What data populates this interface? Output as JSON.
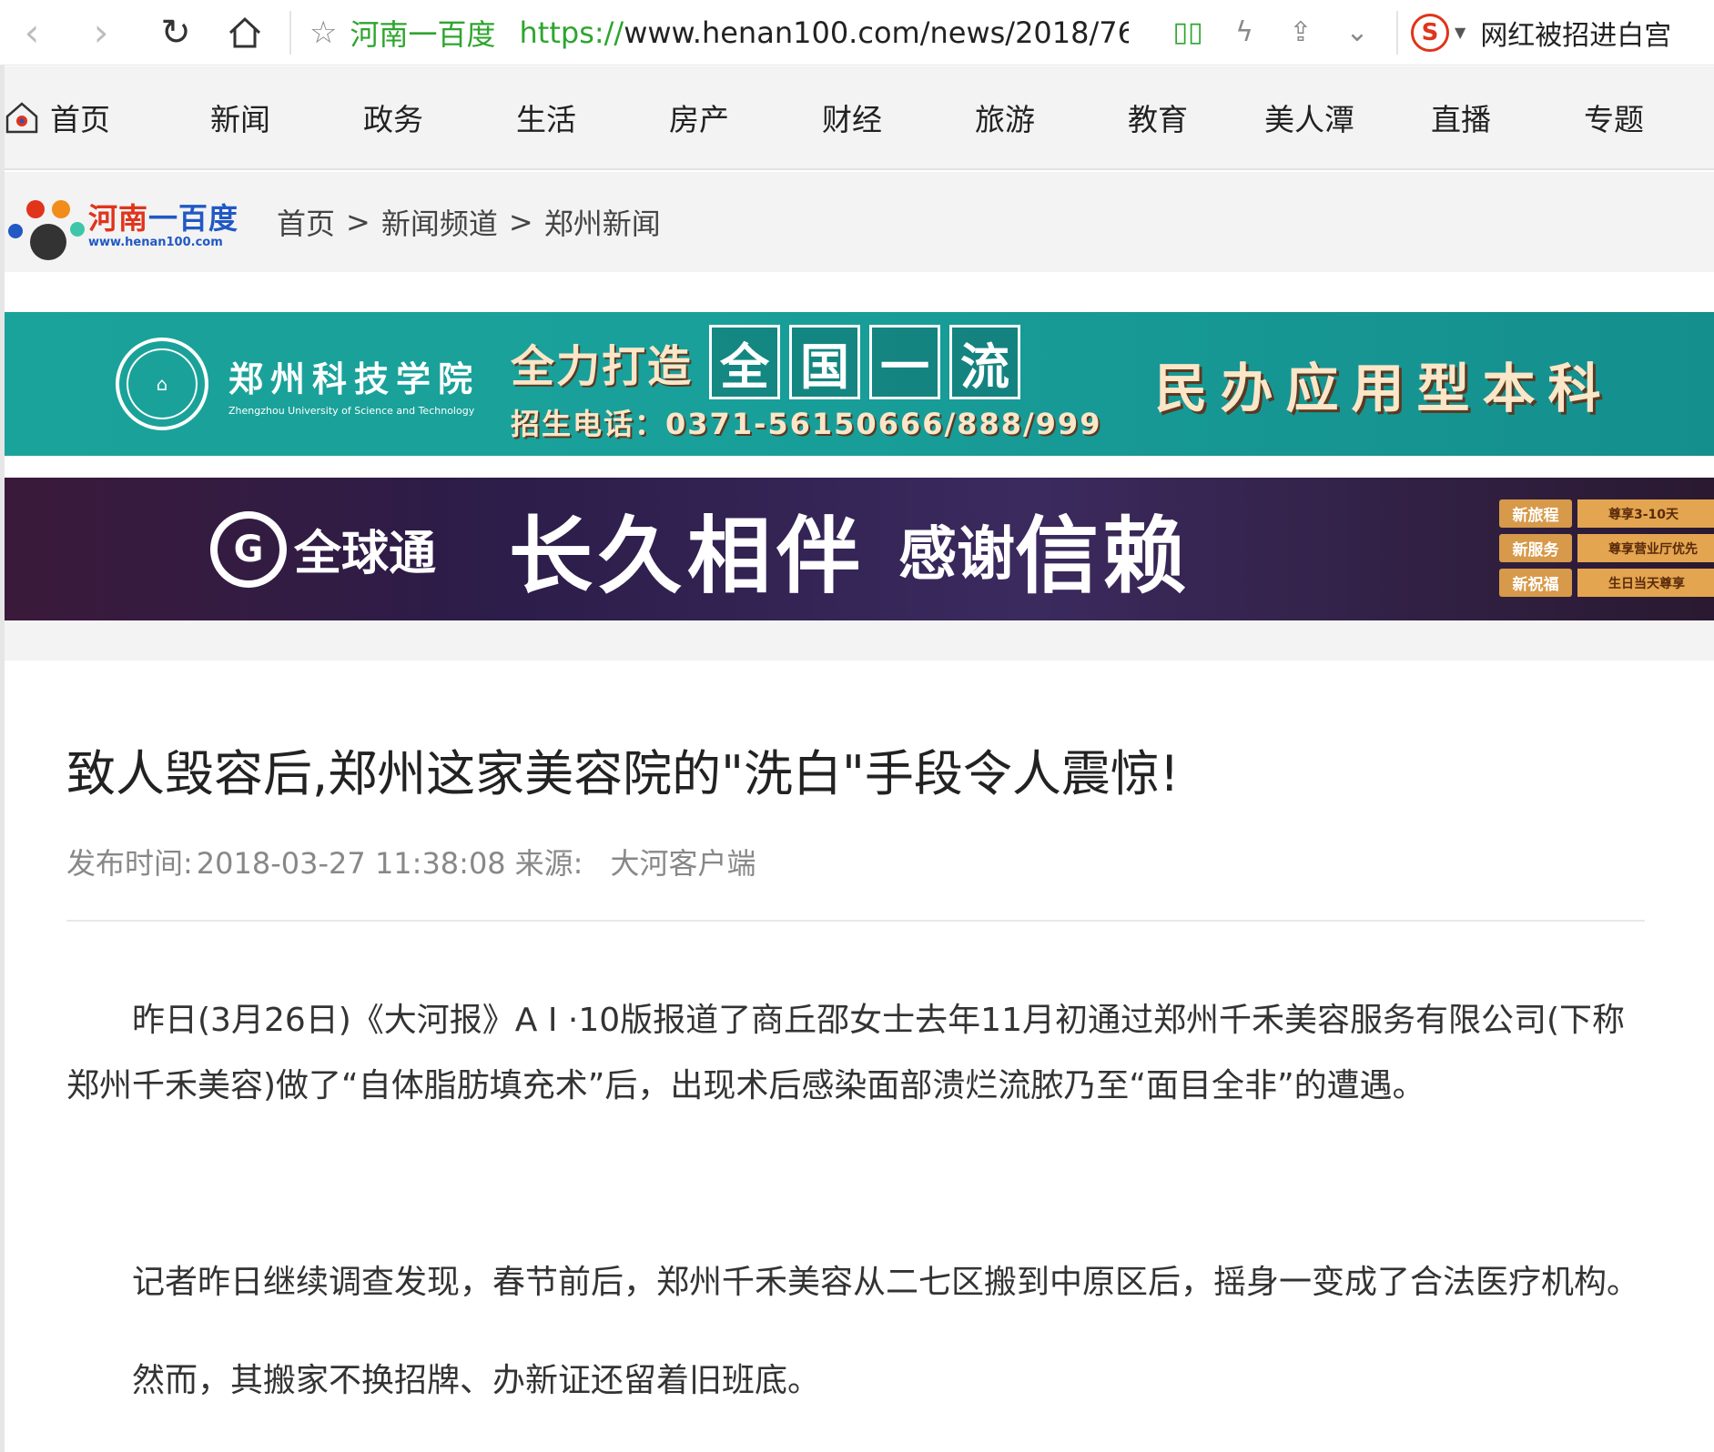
{
  "browser": {
    "site_name": "河南一百度",
    "url_proto": "https://",
    "url_rest": "www.henan100.com/news/2018/76",
    "search_text": "网红被招进白宫",
    "search_engine_letter": "S"
  },
  "nav": {
    "items": [
      "首页",
      "新闻",
      "政务",
      "生活",
      "房产",
      "财经",
      "旅游",
      "教育",
      "美人潭",
      "直播",
      "专题"
    ]
  },
  "logo": {
    "cn_part1": "河南",
    "cn_part2": "一百度",
    "url": "www.henan100.com"
  },
  "breadcrumb": {
    "items": [
      "首页",
      "新闻频道",
      "郑州新闻"
    ],
    "separator": ">"
  },
  "banner1": {
    "school_name": "郑州科技学院",
    "school_en": "Zhengzhou University of Science and Technology",
    "slogan": "全力打造",
    "box_chars": [
      "全",
      "国",
      "一",
      "流"
    ],
    "phone": "招生电话：0371-56150666/888/999",
    "right_text": "民办应用型本科"
  },
  "banner2": {
    "brand": "全球通",
    "slogan_a": "长久相伴",
    "slogan_b": "感谢",
    "slogan_c": "信赖",
    "side_tags": [
      {
        "tag": "新旅程",
        "desc": "尊享3-10天"
      },
      {
        "tag": "新服务",
        "desc": "尊享营业厅优先"
      },
      {
        "tag": "新祝福",
        "desc": "生日当天尊享"
      }
    ]
  },
  "article": {
    "title": "致人毁容后,郑州这家美容院的\"洗白\"手段令人震惊!",
    "meta_time_label": "发布时间:",
    "meta_time": "2018-03-27 11:38:08",
    "meta_source_label": "来源:",
    "meta_source": "大河客户端",
    "p1": "昨日(3月26日)《大河报》A I ·10版报道了商丘邵女士去年11月初通过郑州千禾美容服务有限公司(下称郑州千禾美容)做了“自体脂肪填充术”后，出现术后感染面部溃烂流脓乃至“面目全非”的遭遇。",
    "p2": "记者昨日继续调查发现，春节前后，郑州千禾美容从二七区搬到中原区后，摇身一变成了合法医疗机构。",
    "p3": "然而，其搬家不换招牌、办新证还留着旧班底。"
  },
  "colors": {
    "accent_green": "#2ea52e",
    "logo_blue": "#2158c4",
    "logo_red": "#e0341b"
  }
}
